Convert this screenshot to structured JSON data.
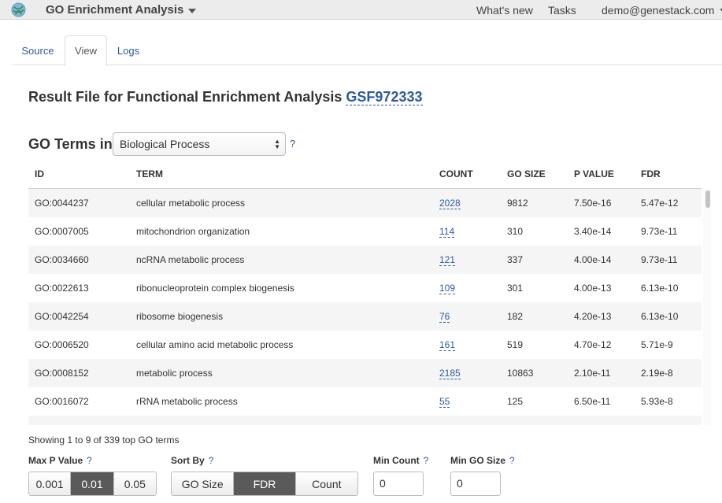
{
  "topbar": {
    "app_title": "GO Enrichment Analysis",
    "whats_new": "What's new",
    "tasks": "Tasks",
    "user": "demo@genestack.com"
  },
  "tabs": [
    {
      "label": "Source"
    },
    {
      "label": "View",
      "active": true
    },
    {
      "label": "Logs"
    }
  ],
  "heading": {
    "prefix": "Result File for Functional Enrichment Analysis",
    "file_id": "GSF972333"
  },
  "go_terms": {
    "label": "GO Terms in",
    "selected": "Biological Process",
    "help": "?"
  },
  "table": {
    "headers": [
      "ID",
      "TERM",
      "COUNT",
      "GO SIZE",
      "P VALUE",
      "FDR"
    ],
    "rows": [
      [
        "GO:0044237",
        "cellular metabolic process",
        "2028",
        "9812",
        "7.50e-16",
        "5.47e-12"
      ],
      [
        "GO:0007005",
        "mitochondrion organization",
        "114",
        "310",
        "3.40e-14",
        "9.73e-11"
      ],
      [
        "GO:0034660",
        "ncRNA metabolic process",
        "121",
        "337",
        "4.00e-14",
        "9.73e-11"
      ],
      [
        "GO:0022613",
        "ribonucleoprotein complex biogenesis",
        "109",
        "301",
        "4.00e-13",
        "6.13e-10"
      ],
      [
        "GO:0042254",
        "ribosome biogenesis",
        "76",
        "182",
        "4.20e-13",
        "6.13e-10"
      ],
      [
        "GO:0006520",
        "cellular amino acid metabolic process",
        "161",
        "519",
        "4.70e-12",
        "5.71e-9"
      ],
      [
        "GO:0008152",
        "metabolic process",
        "2185",
        "10863",
        "2.10e-11",
        "2.19e-8"
      ],
      [
        "GO:0016072",
        "rRNA metabolic process",
        "55",
        "125",
        "6.50e-11",
        "5.93e-8"
      ]
    ]
  },
  "showing": "Showing 1 to 9 of  339 top GO terms",
  "controls": {
    "max_p": {
      "label": "Max P Value",
      "help": "?",
      "options": [
        "0.001",
        "0.01",
        "0.05"
      ],
      "active": "0.01"
    },
    "sort_by": {
      "label": "Sort By",
      "help": "?",
      "options": [
        "GO Size",
        "FDR",
        "Count"
      ],
      "active": "FDR"
    },
    "min_count": {
      "label": "Min Count",
      "help": "?",
      "value": "0"
    },
    "min_go_size": {
      "label": "Min GO Size",
      "help": "?",
      "value": "0"
    }
  },
  "colors": {
    "link": "#2c5aa0",
    "active_button": "#5a5a5a",
    "stripe": "#f5f5f5"
  },
  "icons": {
    "logo": "genestack-logo-icon",
    "dropdown": "caret-down-icon",
    "select": "select-arrows-icon"
  }
}
